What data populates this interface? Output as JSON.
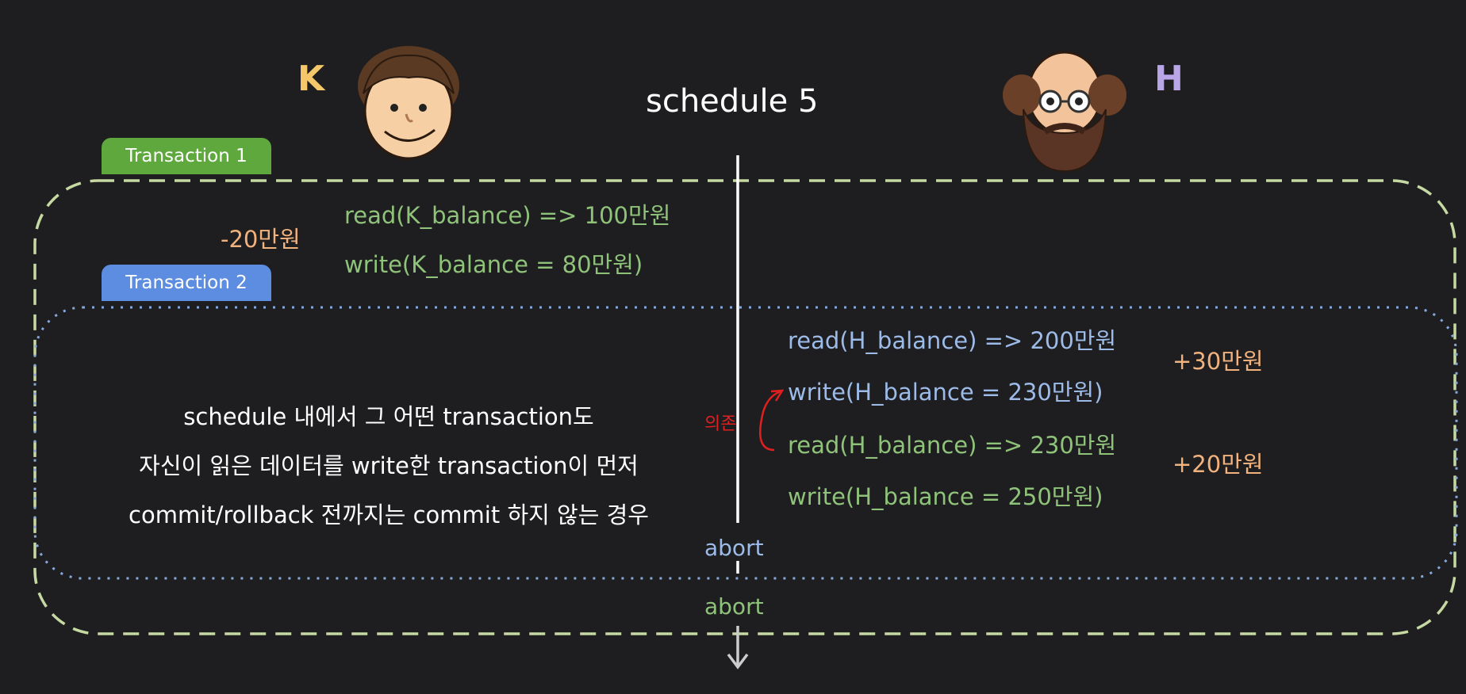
{
  "title": "schedule 5",
  "k_label": "K",
  "h_label": "H",
  "transaction1": {
    "label": "Transaction 1"
  },
  "transaction2": {
    "label": "Transaction 2"
  },
  "k_ops": [
    "read(K_balance) => 100만원",
    "write(K_balance = 80만원)"
  ],
  "k_delta": "-20만원",
  "h_ops": [
    "read(H_balance) => 200만원",
    "write(H_balance = 230만원)",
    "read(H_balance) => 230만원",
    "write(H_balance = 250만원)"
  ],
  "h_deltas": [
    "+30만원",
    "+20만원"
  ],
  "description": [
    "schedule 내에서 그 어떤 transaction도",
    "자신이 읽은 데이터를 write한 transaction이 먼저",
    "commit/rollback 전까지는 commit 하지 않는 경우"
  ],
  "abort_labels": [
    "abort",
    "abort"
  ],
  "annotation": "의존",
  "colors": {
    "background": "#1e1e20",
    "transaction1": "#5ea83d",
    "transaction2": "#5d8de0",
    "green_text": "#8fc37a",
    "blue_text": "#9dbbe8",
    "orange_text": "#f2b27d",
    "k_label": "#f4c86a",
    "h_label": "#b8a6e6",
    "annotation": "#e02020"
  }
}
